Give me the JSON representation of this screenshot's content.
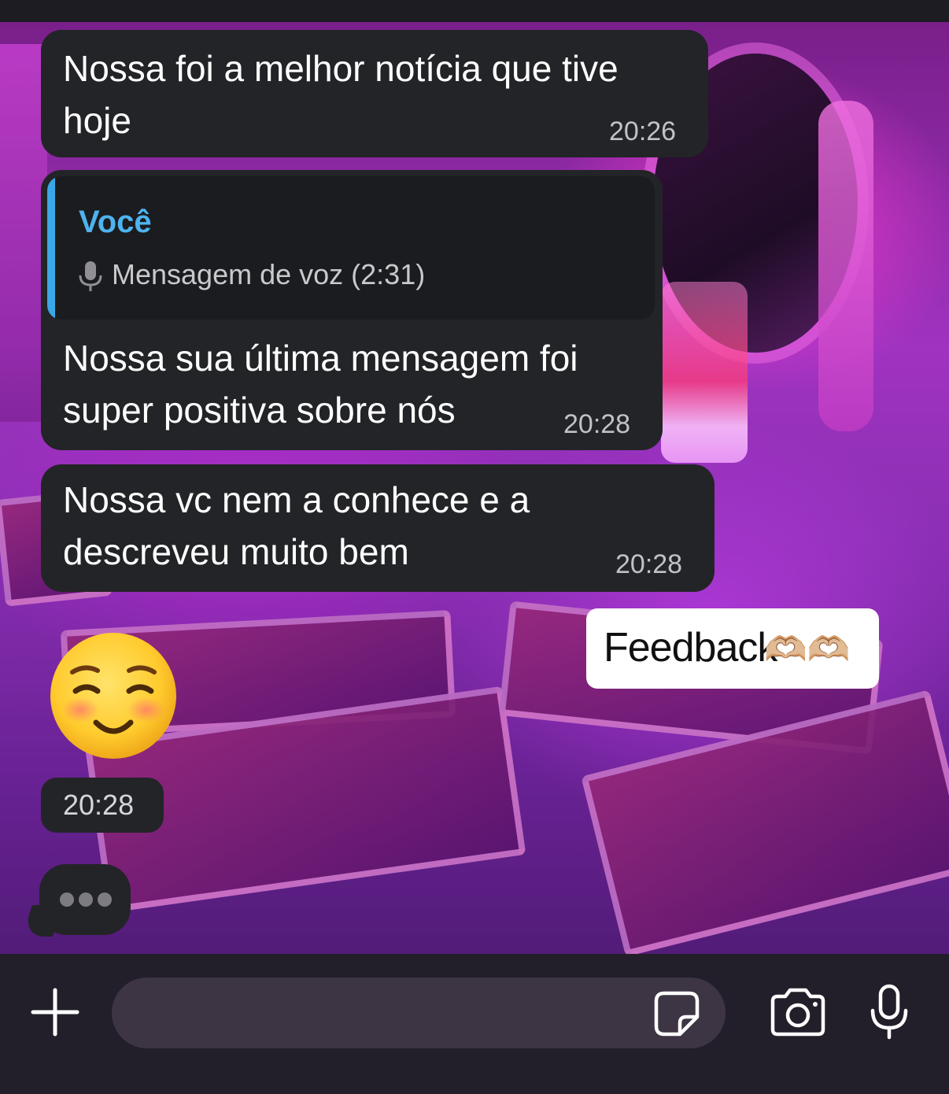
{
  "conversation": {
    "messages": [
      {
        "text": "Nossa foi a melhor notícia que tive\nhoje",
        "time": "20:26"
      },
      {
        "reply": {
          "author": "Você",
          "snippet": "Mensagem de voz (2:31)",
          "snippet_icon": "microphone-icon"
        },
        "text": "Nossa sua última mensagem foi\nsuper positiva sobre nós",
        "time": "20:28"
      },
      {
        "text": "Nossa vc nem a conhece e a\ndescreveu muito bem",
        "time": "20:28"
      }
    ],
    "sticker": {
      "text": "Feedback",
      "emoji": "🫶🏼🫶🏼"
    },
    "emoji_message": {
      "emoji": "☺️",
      "time": "20:28"
    },
    "typing_indicator": "typing-dots"
  },
  "composer": {
    "input_value": "",
    "input_placeholder": "",
    "icons": [
      "plus-icon",
      "sticker-icon",
      "camera-icon",
      "microphone-icon"
    ]
  },
  "colors": {
    "bubble": "#232427",
    "reply_accent": "#3aa8e6",
    "composer_bg": "#231f2a",
    "input_bg": "#3d3543"
  }
}
